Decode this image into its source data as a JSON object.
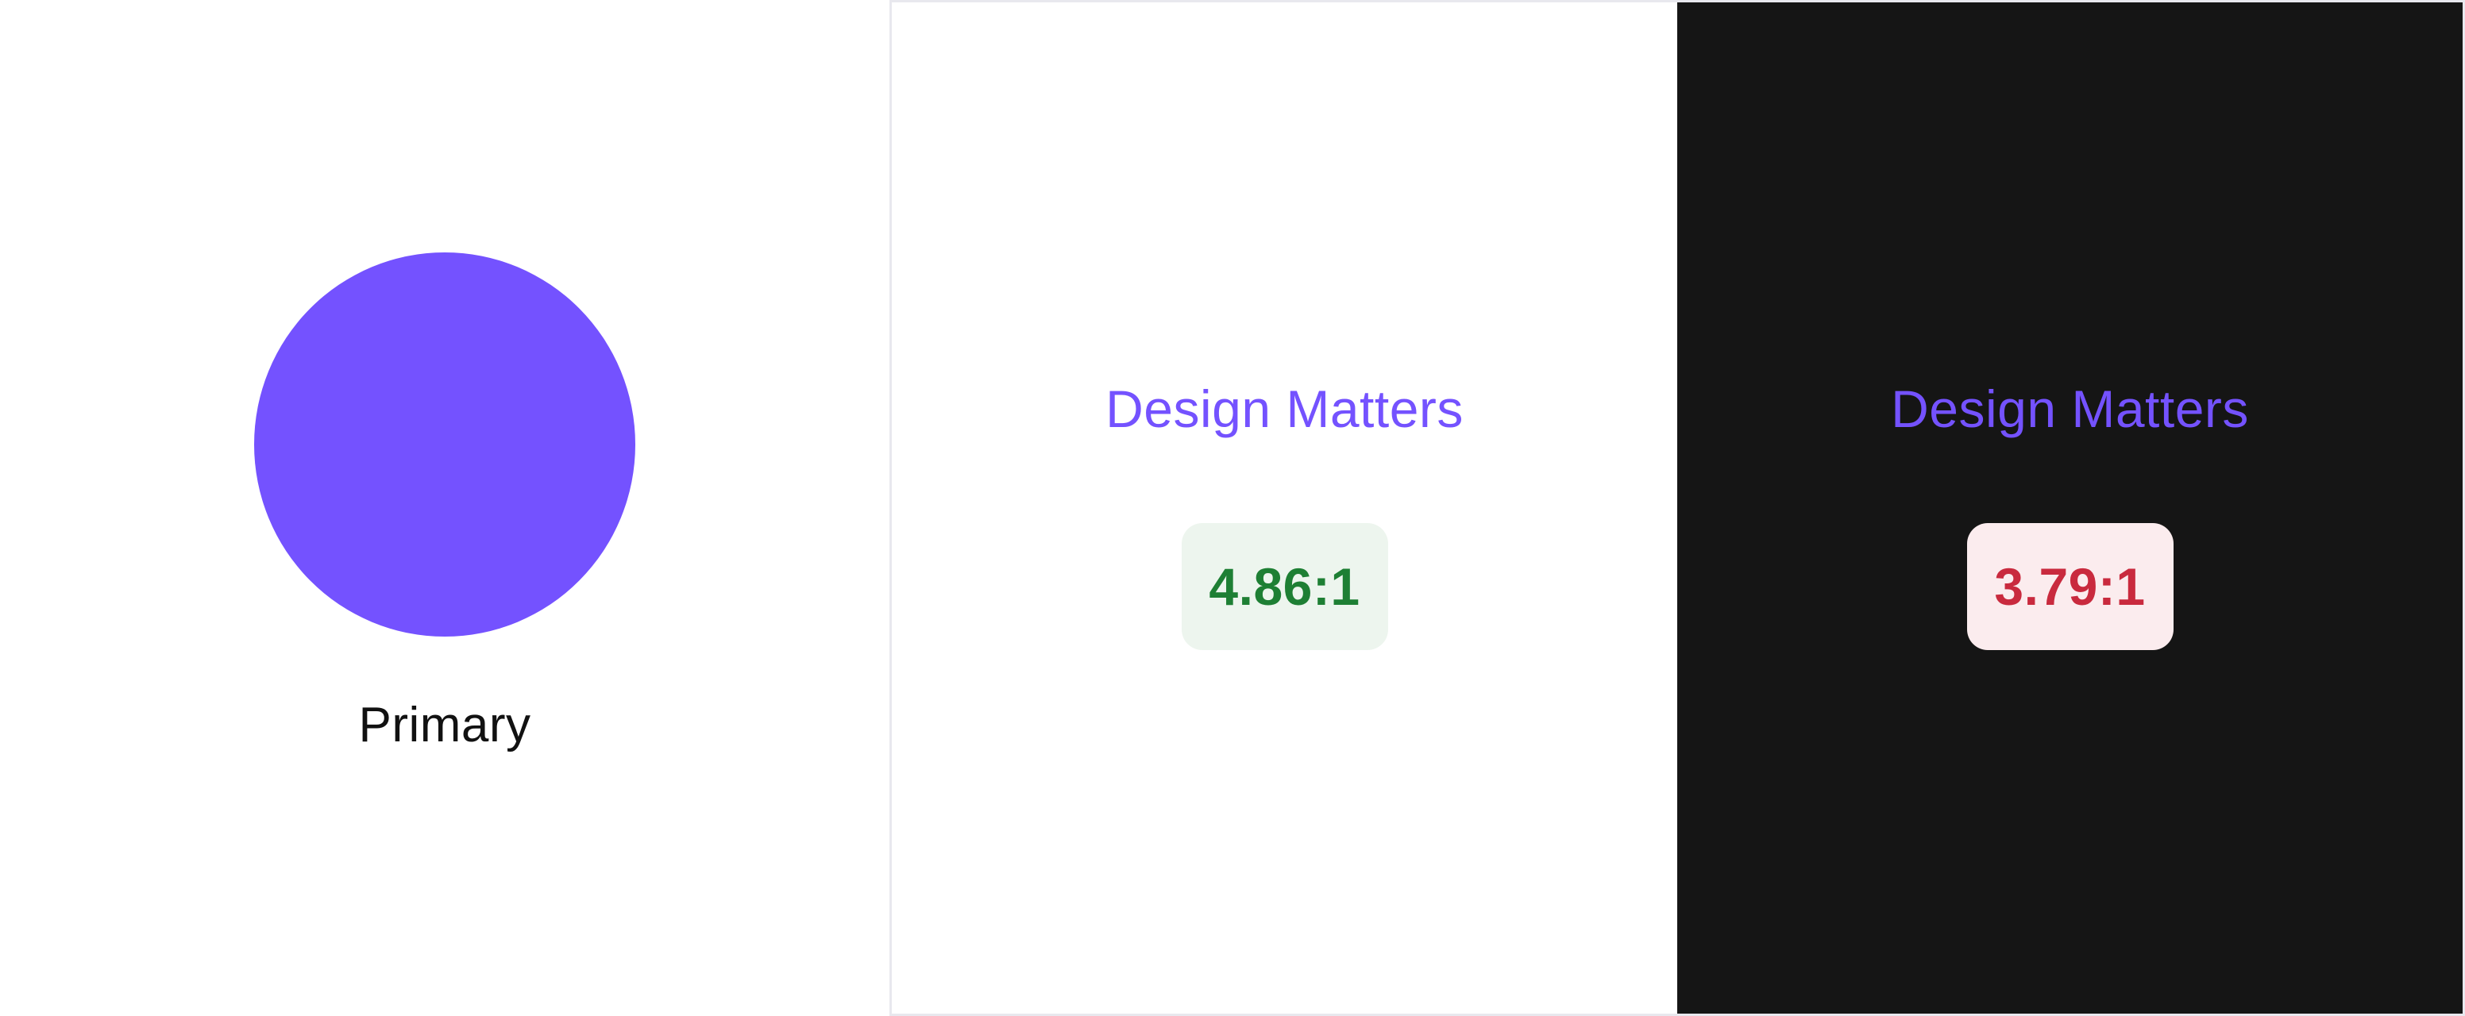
{
  "swatch": {
    "label": "Primary",
    "color": "#7452FF"
  },
  "previews": [
    {
      "background": "light",
      "sample_text": "Design Matters",
      "text_color": "#7452FF",
      "contrast_ratio": "4.86:1",
      "badge_status": "pass",
      "badge_text_color": "#1E7F34",
      "badge_bg_color": "#EDF5EE"
    },
    {
      "background": "dark",
      "sample_text": "Design Matters",
      "text_color": "#7452FF",
      "contrast_ratio": "3.79:1",
      "badge_status": "fail",
      "badge_text_color": "#C92A3E",
      "badge_bg_color": "#FBECEE"
    }
  ]
}
